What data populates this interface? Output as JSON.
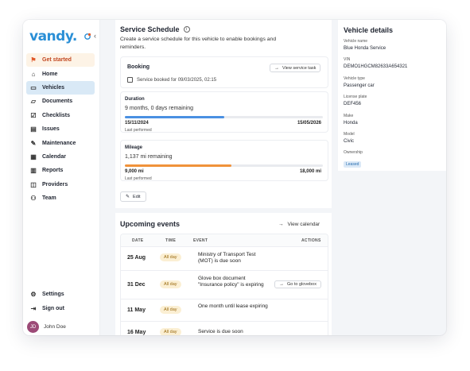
{
  "brand": {
    "logo_text": "vandy."
  },
  "sidebar": {
    "collapse_icon": "chevron-left",
    "items": [
      {
        "label": "Get started",
        "icon": "rocket-icon"
      },
      {
        "label": "Home",
        "icon": "home-icon"
      },
      {
        "label": "Vehicles",
        "icon": "car-icon"
      },
      {
        "label": "Documents",
        "icon": "folder-icon"
      },
      {
        "label": "Checklists",
        "icon": "checklist-icon"
      },
      {
        "label": "Issues",
        "icon": "clipboard-icon"
      },
      {
        "label": "Maintenance",
        "icon": "wrench-icon"
      },
      {
        "label": "Calendar",
        "icon": "calendar-icon"
      },
      {
        "label": "Reports",
        "icon": "chart-icon"
      },
      {
        "label": "Providers",
        "icon": "providers-icon"
      },
      {
        "label": "Team",
        "icon": "team-icon"
      }
    ],
    "bottom": [
      {
        "label": "Settings",
        "icon": "gear-icon"
      },
      {
        "label": "Sign out",
        "icon": "sign-out-icon"
      }
    ],
    "user": {
      "initials": "JD",
      "name": "John Doe"
    }
  },
  "schedule": {
    "title": "Service Schedule",
    "description": "Create a service schedule for this vehicle to enable bookings and reminders.",
    "booking": {
      "label": "Booking",
      "detail": "Service booked for 09/03/2025, 02:15",
      "button": "View service task"
    },
    "duration": {
      "label": "Duration",
      "value": "9 months, 0 days remaining",
      "start": "15/11/2024",
      "end": "15/05/2026",
      "note": "Last performed",
      "progress": 0.5,
      "color": "#4a90e2"
    },
    "mileage": {
      "label": "Mileage",
      "value": "1,137 mi remaining",
      "start": "9,000 mi",
      "end": "18,000 mi",
      "note": "Last performed",
      "progress": 0.54,
      "color": "#f0923a"
    },
    "edit_label": "Edit"
  },
  "events": {
    "title": "Upcoming events",
    "view_calendar": "View calendar",
    "columns": {
      "date": "DATE",
      "time": "TIME",
      "event": "EVENT",
      "actions": "ACTIONS"
    },
    "rows": [
      {
        "date": "25 Aug",
        "time": "All day",
        "event": "Ministry of Transport Test (MOT) is due soon",
        "action": ""
      },
      {
        "date": "31 Dec",
        "time": "All day",
        "event": "Glove box document \"Insurance policy\" is expiring",
        "action": "Go to glovebox"
      },
      {
        "date": "11 May",
        "time": "All day",
        "event": "One month until lease expiring",
        "action": ""
      },
      {
        "date": "16 May",
        "time": "All day",
        "event": "Service is due soon",
        "action": ""
      }
    ]
  },
  "vehicle": {
    "title": "Vehicle details",
    "fields": [
      {
        "key": "Vehicle name",
        "value": "Blue Honda Service"
      },
      {
        "key": "VIN",
        "value": "DEMO1HGCM82633A654321"
      },
      {
        "key": "Vehicle type",
        "value": "Passenger car"
      },
      {
        "key": "License plate",
        "value": "DEF456"
      },
      {
        "key": "Make",
        "value": "Honda"
      },
      {
        "key": "Model",
        "value": "Civic"
      }
    ],
    "ownership": {
      "key": "Ownership",
      "value": "Leased"
    }
  }
}
